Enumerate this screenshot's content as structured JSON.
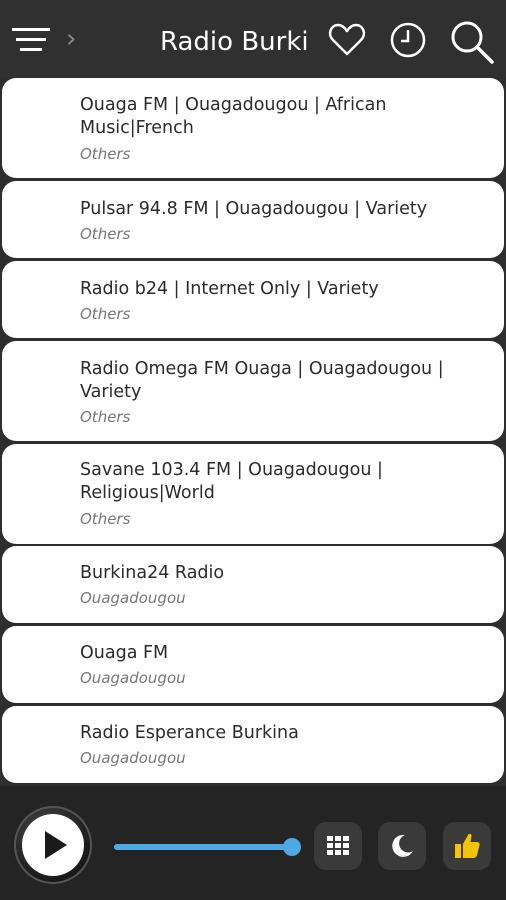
{
  "app": {
    "title": "Radio Burkina"
  },
  "stations": [
    {
      "name": "Ouaga FM | Ouagadougou | African Music|French",
      "subtitle": "Others"
    },
    {
      "name": "Pulsar 94.8 FM | Ouagadougou | Variety",
      "subtitle": "Others"
    },
    {
      "name": "Radio b24 | Internet Only | Variety",
      "subtitle": "Others"
    },
    {
      "name": "Radio Omega FM Ouaga | Ouagadougou | Variety",
      "subtitle": "Others"
    },
    {
      "name": "Savane 103.4 FM | Ouagadougou | Religious|World",
      "subtitle": "Others"
    },
    {
      "name": "Burkina24 Radio",
      "subtitle": "Ouagadougou"
    },
    {
      "name": "Ouaga FM",
      "subtitle": "Ouagadougou"
    },
    {
      "name": "Radio Esperance Burkina",
      "subtitle": "Ouagadougou"
    }
  ],
  "player": {
    "volume_fraction": 1.0
  },
  "colors": {
    "topbar": "#303030",
    "card": "#ffffff",
    "accent": "#4ea9e2",
    "like": "#f5c400"
  },
  "icons": {
    "menu": "menu-icon",
    "favorite": "heart-icon",
    "history": "clock-icon",
    "search": "search-icon",
    "play": "play-icon",
    "grid": "grid-icon",
    "sleep": "moon-icon",
    "like": "thumbs-up-icon"
  }
}
